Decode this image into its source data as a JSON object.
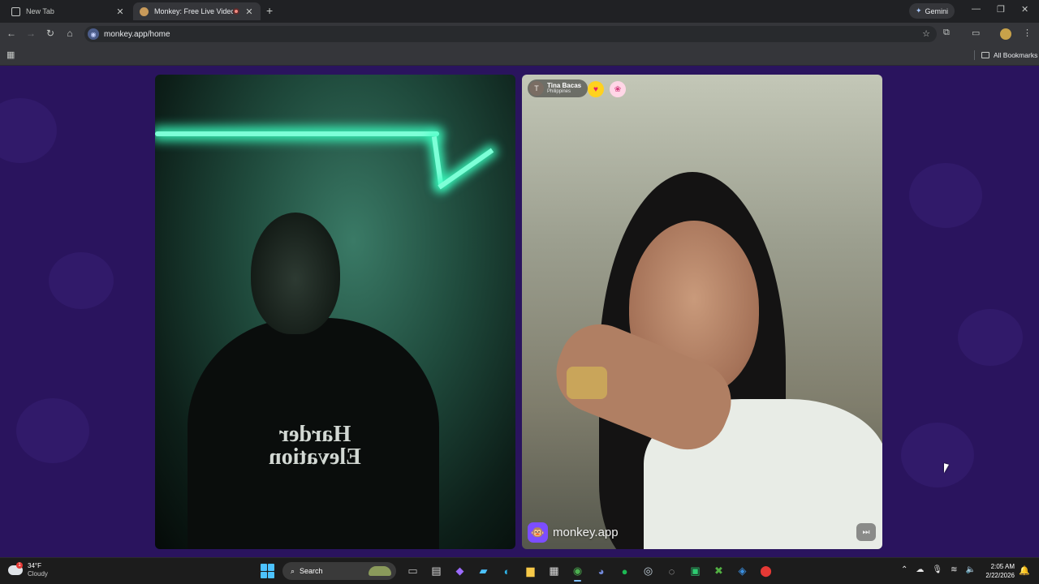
{
  "browser": {
    "tabs": [
      {
        "title": "New Tab",
        "active": false
      },
      {
        "title": "Monkey: Free Live Video Ch",
        "active": true,
        "recording": true
      }
    ],
    "new_tab_symbol": "+",
    "gemini_label": "Gemini",
    "url": "monkey.app/home",
    "bookmarks_label": "All Bookmarks"
  },
  "page": {
    "background_color": "#2a145e",
    "left_video": {
      "hoodie_text": "Harder Elevation"
    },
    "right_video": {
      "user_initial": "T",
      "user_name": "Tina Bacas",
      "user_country": "Philippines",
      "brand_text": "monkey.app"
    }
  },
  "taskbar": {
    "weather_temp": "34°F",
    "weather_desc": "Cloudy",
    "weather_alert": "1",
    "search_label": "Search",
    "time": "2:05 AM",
    "date": "2/22/2026",
    "apps": [
      "task-view",
      "file-explorer-icon",
      "copilot",
      "microsoft-store",
      "edge",
      "folder",
      "calendar",
      "chrome",
      "discord",
      "spotify",
      "steam",
      "obs",
      "app-green",
      "xbox",
      "app-blue",
      "app-red"
    ]
  }
}
